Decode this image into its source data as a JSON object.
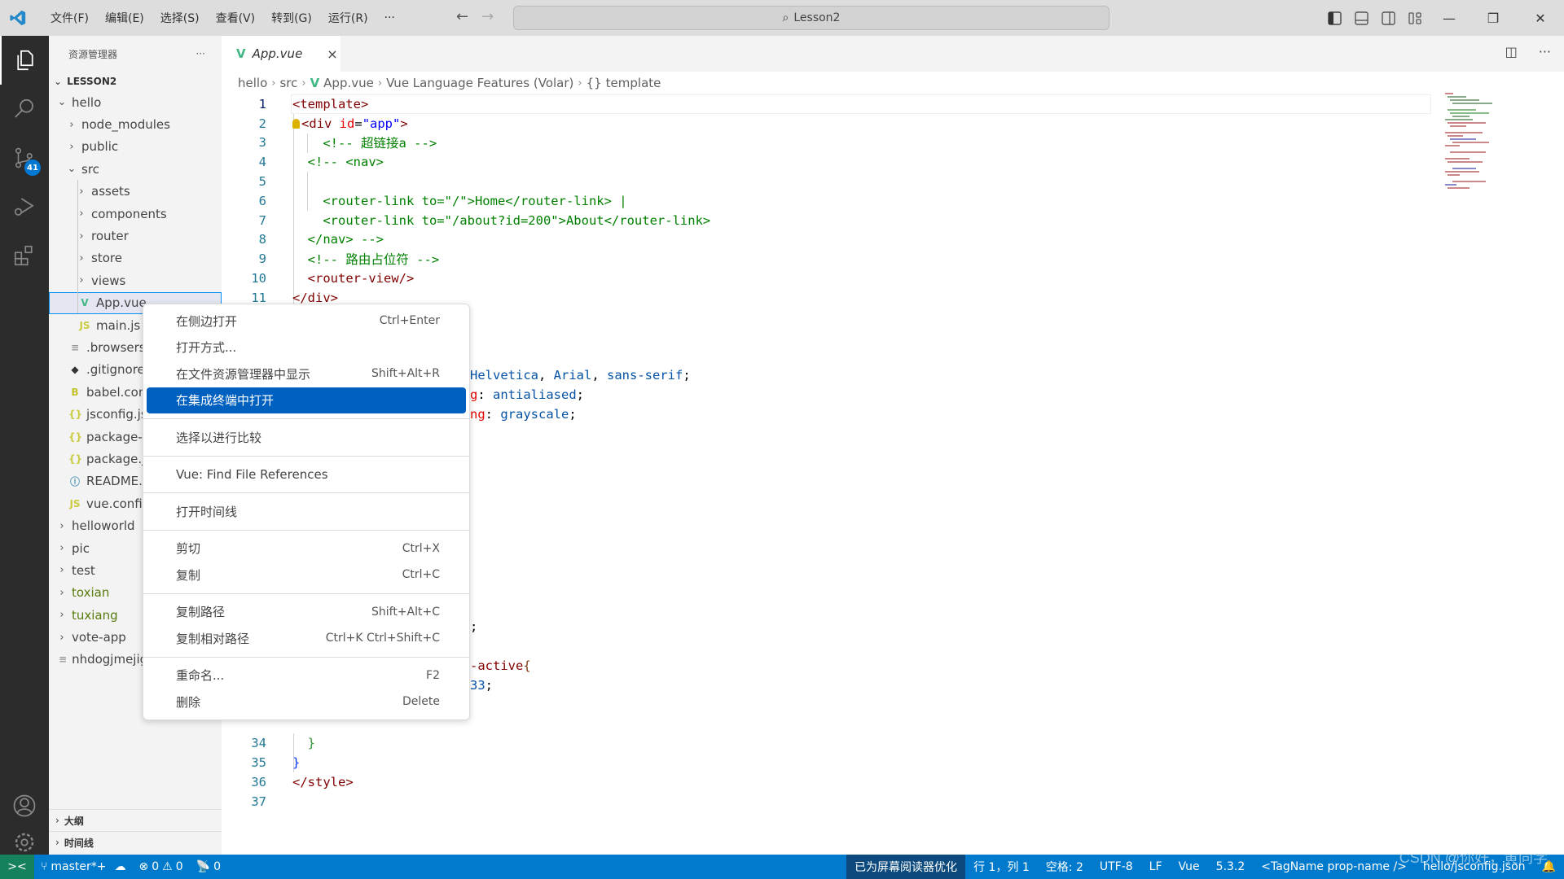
{
  "titlebar": {
    "menu": [
      "文件(F)",
      "编辑(E)",
      "选择(S)",
      "查看(V)",
      "转到(G)",
      "运行(R)",
      "···"
    ],
    "command_center": "Lesson2"
  },
  "activity_bar": {
    "items": [
      "explorer",
      "search",
      "source-control",
      "run-debug",
      "extensions"
    ],
    "source_control_badge": "41"
  },
  "sidebar": {
    "title": "资源管理器",
    "more": "···",
    "root": "LESSON2",
    "items": [
      {
        "label": "hello",
        "type": "folder-open",
        "level": 1
      },
      {
        "label": "node_modules",
        "type": "folder",
        "level": 2
      },
      {
        "label": "public",
        "type": "folder",
        "level": 2
      },
      {
        "label": "src",
        "type": "folder-open",
        "level": 2
      },
      {
        "label": "assets",
        "type": "folder",
        "level": 3
      },
      {
        "label": "components",
        "type": "folder",
        "level": 3
      },
      {
        "label": "router",
        "type": "folder",
        "level": 3
      },
      {
        "label": "store",
        "type": "folder",
        "level": 3
      },
      {
        "label": "views",
        "type": "folder",
        "level": 3
      },
      {
        "label": "App.vue",
        "type": "vue",
        "level": 3,
        "selected": true
      },
      {
        "label": "main.js",
        "type": "js",
        "level": 3
      },
      {
        "label": ".browserslistrc",
        "type": "text",
        "level": 2
      },
      {
        "label": ".gitignore",
        "type": "git",
        "level": 2
      },
      {
        "label": "babel.config.js",
        "type": "babel",
        "level": 2
      },
      {
        "label": "jsconfig.json",
        "type": "json",
        "level": 2
      },
      {
        "label": "package-lock.json",
        "type": "json",
        "level": 2
      },
      {
        "label": "package.json",
        "type": "json",
        "level": 2
      },
      {
        "label": "README.md",
        "type": "info",
        "level": 2
      },
      {
        "label": "vue.config.js",
        "type": "js",
        "level": 2
      },
      {
        "label": "helloworld",
        "type": "folder",
        "level": 1
      },
      {
        "label": "pic",
        "type": "folder",
        "level": 1
      },
      {
        "label": "test",
        "type": "folder",
        "level": 1
      },
      {
        "label": "toxian",
        "type": "folder",
        "level": 1,
        "git": "untracked"
      },
      {
        "label": "tuxiang",
        "type": "folder",
        "level": 1,
        "git": "untracked"
      },
      {
        "label": "vote-app",
        "type": "folder",
        "level": 1
      },
      {
        "label": "nhdogjmejiglipccpnnnanhbledajbpd",
        "type": "text",
        "level": 1
      }
    ],
    "outline": "大纲",
    "timeline": "时间线"
  },
  "editor": {
    "tab": {
      "label": "App.vue",
      "close": "×"
    },
    "breadcrumb": [
      "hello",
      "src",
      "App.vue",
      "Vue Language Features (Volar)",
      "template"
    ],
    "lines": [
      {
        "n": "1",
        "html": "<span class=\"tg\">&lt;template&gt;</span>"
      },
      {
        "n": "2",
        "html": "<span class=\"bulb\"></span><span class=\"tg\">&lt;div</span> <span class=\"at\">id</span><span class=\"tx\">=</span><span class=\"av\">\"app\"</span><span class=\"tg\">&gt;</span>"
      },
      {
        "n": "3",
        "html": "    <span class=\"cm\">&lt;!-- 超链接a --&gt;</span>"
      },
      {
        "n": "4",
        "html": "  <span class=\"cm\">&lt;!-- &lt;nav&gt;</span>"
      },
      {
        "n": "5",
        "html": ""
      },
      {
        "n": "6",
        "html": "    <span class=\"cm\">&lt;router-link to=\"/\"&gt;Home&lt;/router-link&gt; |</span>"
      },
      {
        "n": "7",
        "html": "    <span class=\"cm\">&lt;router-link to=\"/about?id=200\"&gt;About&lt;/router-link&gt;</span>"
      },
      {
        "n": "8",
        "html": "  <span class=\"cm\">&lt;/nav&gt; --&gt;</span>"
      },
      {
        "n": "9",
        "html": "  <span class=\"cm\">&lt;!-- 路由占位符 --&gt;</span>"
      },
      {
        "n": "10",
        "html": "  <span class=\"tg\">&lt;router-view/&gt;</span>"
      },
      {
        "n": "11",
        "html": "<span class=\"tg\">&lt;/div&gt;</span>"
      },
      {
        "n": "34",
        "html": "  <span class=\"br2\">}</span>"
      },
      {
        "n": "35",
        "html": "<span class=\"br1\">}</span>"
      },
      {
        "n": "36",
        "html": "<span class=\"tg\">&lt;/style&gt;</span>"
      },
      {
        "n": "37",
        "html": ""
      }
    ],
    "partial_lines": [
      {
        "row": 15,
        "text_html": "<span class=\"pv\">Helvetica</span>, <span class=\"pv\">Arial</span>, <span class=\"pv\">sans-serif</span>;"
      },
      {
        "row": 16,
        "text_html": "<span class=\"at\">g</span>: <span class=\"pv\">antialiased</span>;"
      },
      {
        "row": 17,
        "text_html": "<span class=\"at\">ng</span>: <span class=\"pv\">grayscale</span>;"
      },
      {
        "row": 28,
        "text_html": ";"
      },
      {
        "row": 30,
        "text_html": "<span class=\"tg\">-active</span> <span class=\"br3\">{</span>"
      },
      {
        "row": 31,
        "text_html": "<span class=\"pv\">33</span>;"
      }
    ]
  },
  "context_menu": {
    "groups": [
      [
        {
          "label": "在侧边打开",
          "shortcut": "Ctrl+Enter"
        },
        {
          "label": "打开方式...",
          "shortcut": ""
        },
        {
          "label": "在文件资源管理器中显示",
          "shortcut": "Shift+Alt+R"
        },
        {
          "label": "在集成终端中打开",
          "shortcut": "",
          "highlighted": true
        }
      ],
      [
        {
          "label": "选择以进行比较",
          "shortcut": ""
        }
      ],
      [
        {
          "label": "Vue: Find File References",
          "shortcut": ""
        }
      ],
      [
        {
          "label": "打开时间线",
          "shortcut": ""
        }
      ],
      [
        {
          "label": "剪切",
          "shortcut": "Ctrl+X"
        },
        {
          "label": "复制",
          "shortcut": "Ctrl+C"
        }
      ],
      [
        {
          "label": "复制路径",
          "shortcut": "Shift+Alt+C"
        },
        {
          "label": "复制相对路径",
          "shortcut": "Ctrl+K Ctrl+Shift+C"
        }
      ],
      [
        {
          "label": "重命名...",
          "shortcut": "F2"
        },
        {
          "label": "删除",
          "shortcut": "Delete"
        }
      ]
    ]
  },
  "statusbar": {
    "branch": "master*+",
    "errors": "0",
    "warnings": "0",
    "ports": "0",
    "screen_reader": "已为屏幕阅读器优化",
    "position": "行 1，列 1",
    "indent": "空格: 2",
    "encoding": "UTF-8",
    "eol": "LF",
    "language": "Vue",
    "version": "5.3.2",
    "tag_format": "<TagName prop-name />",
    "tsconfig": "hello/jsconfig.json"
  },
  "watermark": "CSDN @你好，黄同学",
  "colors": {
    "accent": "#007acc",
    "menu_highlight": "#0060c0",
    "remote": "#16825d",
    "badge": "#0078d4"
  }
}
